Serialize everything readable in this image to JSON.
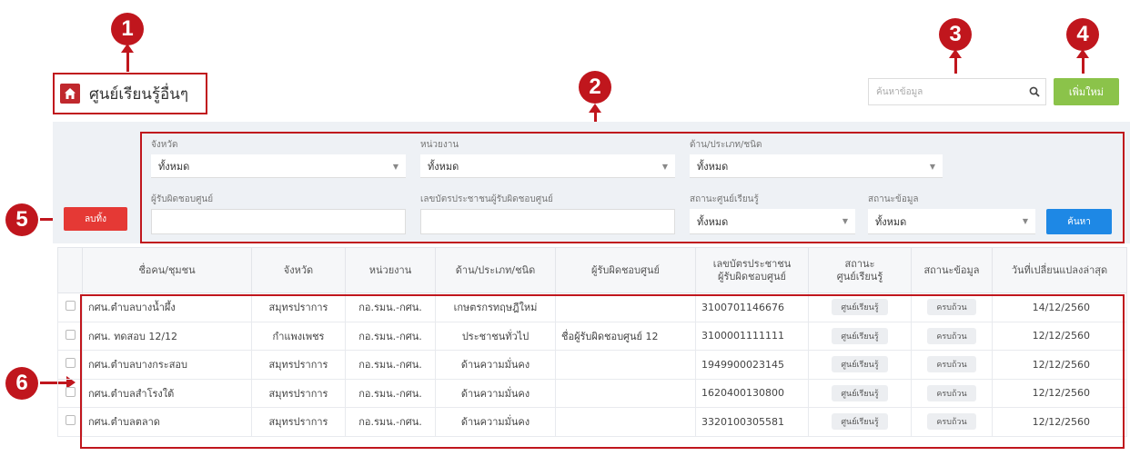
{
  "header": {
    "title": "ศูนย์เรียนรู้อื่นๆ",
    "search_placeholder": "ค้นหาข้อมูล",
    "add_label": "เพิ่มใหม่"
  },
  "filters": {
    "province": {
      "label": "จังหวัด",
      "value": "ทั้งหมด"
    },
    "agency": {
      "label": "หน่วยงาน",
      "value": "ทั้งหมด"
    },
    "category": {
      "label": "ด้าน/ประเภท/ชนิด",
      "value": "ทั้งหมด"
    },
    "owner": {
      "label": "ผู้รับผิดชอบศูนย์"
    },
    "owner_id": {
      "label": "เลขบัตรประชาชนผู้รับผิดชอบศูนย์"
    },
    "center_status": {
      "label": "สถานะศูนย์เรียนรู้",
      "value": "ทั้งหมด"
    },
    "data_status": {
      "label": "สถานะข้อมูล",
      "value": "ทั้งหมด"
    },
    "reset_label": "ลบทิ้ง",
    "search_label": "ค้นหา"
  },
  "table": {
    "columns": [
      "ชื่อคน/ชุมชน",
      "จังหวัด",
      "หน่วยงาน",
      "ด้าน/ประเภท/ชนิด",
      "ผู้รับผิดชอบศูนย์",
      "เลขบัตรประชาชน\nผู้รับผิดชอบศูนย์",
      "สถานะ\nศูนย์เรียนรู้",
      "สถานะข้อมูล",
      "วันที่เปลี่ยนแปลงล่าสุด"
    ],
    "rows": [
      {
        "name": "กศน.ตำบลบางน้ำผึ้ง",
        "province": "สมุทรปราการ",
        "agency": "กอ.รมน.-กศน.",
        "category": "เกษตรกรทฤษฎีใหม่",
        "owner": "",
        "id": "3100701146676",
        "center_status": "ศูนย์เรียนรู้",
        "data_status": "ครบถ้วน",
        "date": "14/12/2560"
      },
      {
        "name": "กศน. ทดสอบ 12/12",
        "province": "กำแพงเพชร",
        "agency": "กอ.รมน.-กศน.",
        "category": "ประชาชนทั่วไป",
        "owner": "ชื่อผู้รับผิดชอบศูนย์ 12",
        "id": "3100001111111",
        "center_status": "ศูนย์เรียนรู้",
        "data_status": "ครบถ้วน",
        "date": "12/12/2560"
      },
      {
        "name": "กศน.ตำบลบางกระสอบ",
        "province": "สมุทรปราการ",
        "agency": "กอ.รมน.-กศน.",
        "category": "ด้านความมั่นคง",
        "owner": "",
        "id": "1949900023145",
        "center_status": "ศูนย์เรียนรู้",
        "data_status": "ครบถ้วน",
        "date": "12/12/2560"
      },
      {
        "name": "กศน.ตำบลสำโรงใต้",
        "province": "สมุทรปราการ",
        "agency": "กอ.รมน.-กศน.",
        "category": "ด้านความมั่นคง",
        "owner": "",
        "id": "1620400130800",
        "center_status": "ศูนย์เรียนรู้",
        "data_status": "ครบถ้วน",
        "date": "12/12/2560"
      },
      {
        "name": "กศน.ตำบลตลาด",
        "province": "สมุทรปราการ",
        "agency": "กอ.รมน.-กศน.",
        "category": "ด้านความมั่นคง",
        "owner": "",
        "id": "3320100305581",
        "center_status": "ศูนย์เรียนรู้",
        "data_status": "ครบถ้วน",
        "date": "12/12/2560"
      }
    ]
  },
  "markers": [
    "1",
    "2",
    "3",
    "4",
    "5",
    "6"
  ],
  "colors": {
    "marker": "#c0161d",
    "add": "#8bc34a",
    "reset": "#e53935",
    "search": "#1e88e5"
  }
}
